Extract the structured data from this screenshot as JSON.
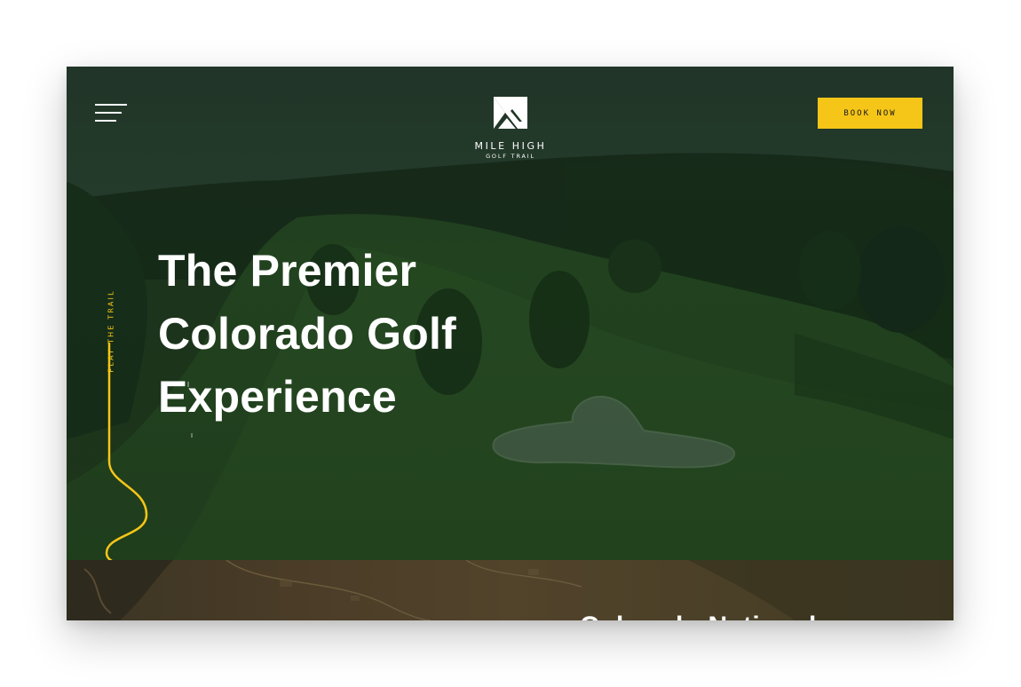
{
  "header": {
    "menu_icon": "hamburger-menu-icon",
    "logo": {
      "icon": "mountain-logo-icon",
      "line1": "MILE HIGH",
      "line2": "GOLF TRAIL"
    },
    "book_button_label": "BOOK NOW"
  },
  "hero": {
    "headline": [
      "The Premier",
      "Colorado Golf",
      "Experience"
    ],
    "vertical_label": "PLAY THE TRAIL",
    "background": "aerial-golf-course-photo"
  },
  "next_section": {
    "heading_partial": "Colorado National"
  },
  "colors": {
    "accent": "#F5C518",
    "overlay": "#1E3A22",
    "text": "#FFFFFF"
  }
}
